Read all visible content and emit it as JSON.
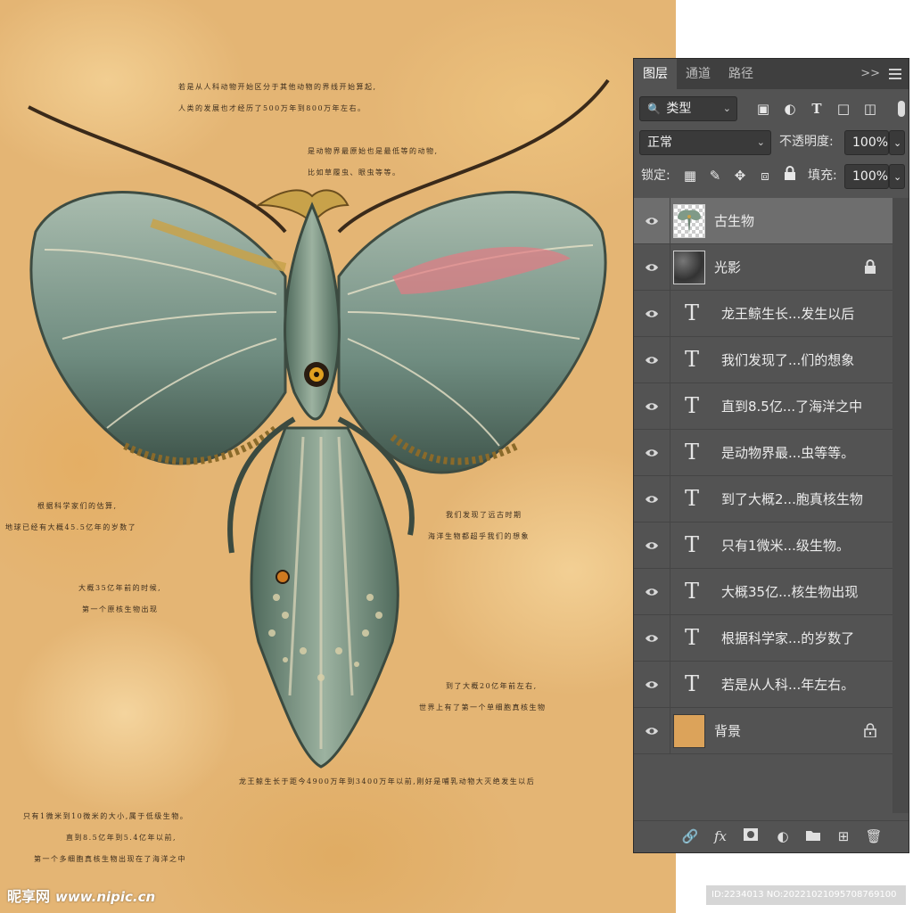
{
  "canvas": {
    "notes": [
      [
        "若是从人科动物开始区分于其他动物的界线开始算起,",
        "人类的发展也才经历了500万年到800万年左右。"
      ],
      [
        "是动物界最原始也是最低等的动物,",
        "比如草履虫、眼虫等等。"
      ],
      [
        "根据科学家们的估算,",
        "地球已经有大概45.5亿年的岁数了"
      ],
      [
        "我们发现了远古时期",
        "海洋生物都超乎我们的想象"
      ],
      [
        "大概35亿年前的时候,",
        "第一个原核生物出现"
      ],
      [
        "到了大概20亿年前左右,",
        "世界上有了第一个单细胞真核生物"
      ],
      [
        "龙王鲸生长于距今4900万年到3400万年以前,刚好是哺乳动物大灭绝发生以后"
      ],
      [
        "只有1微米到10微米的大小,属于低级生物。",
        "直到8.5亿年到5.4亿年以前,",
        "第一个多细胞真核生物出现在了海洋之中"
      ]
    ],
    "watermark_brand": "昵享网",
    "watermark_site": "www.nipic.cn",
    "image_id": "ID:2234013 NO:20221021095708769100",
    "colors": {
      "background": "#e4b574"
    }
  },
  "panel": {
    "tabs": [
      "图层",
      "通道",
      "路径"
    ],
    "collapse_label": ">>",
    "filter": {
      "search_icon": "search-icon",
      "value": "类型"
    },
    "blend_mode": "正常",
    "opacity_label": "不透明度:",
    "opacity_value": "100%",
    "lock_label": "锁定:",
    "fill_label": "填充:",
    "fill_value": "100%",
    "layers": [
      {
        "name": "古生物",
        "kind": "image",
        "selected": true,
        "locked": false
      },
      {
        "name": "光影",
        "kind": "texture",
        "selected": false,
        "locked": true
      },
      {
        "name": "龙王鲸生长...发生以后",
        "kind": "text"
      },
      {
        "name": "我们发现了...们的想象",
        "kind": "text"
      },
      {
        "name": "直到8.5亿...了海洋之中",
        "kind": "text"
      },
      {
        "name": "是动物界最...虫等等。",
        "kind": "text"
      },
      {
        "name": "到了大概2...胞真核生物",
        "kind": "text"
      },
      {
        "name": "只有1微米...级生物。",
        "kind": "text"
      },
      {
        "name": "大概35亿...核生物出现",
        "kind": "text"
      },
      {
        "name": "根据科学家...的岁数了",
        "kind": "text"
      },
      {
        "name": "若是从人科...年左右。",
        "kind": "text"
      },
      {
        "name": "背景",
        "kind": "fill",
        "selected": false,
        "locked": true,
        "color": "#dca35a"
      }
    ],
    "text_icon": "T",
    "footer_icons": [
      "link-layers-icon",
      "fx-icon",
      "add-mask-icon",
      "adjustment-layer-icon",
      "new-group-icon",
      "new-layer-icon",
      "delete-layer-icon"
    ]
  }
}
